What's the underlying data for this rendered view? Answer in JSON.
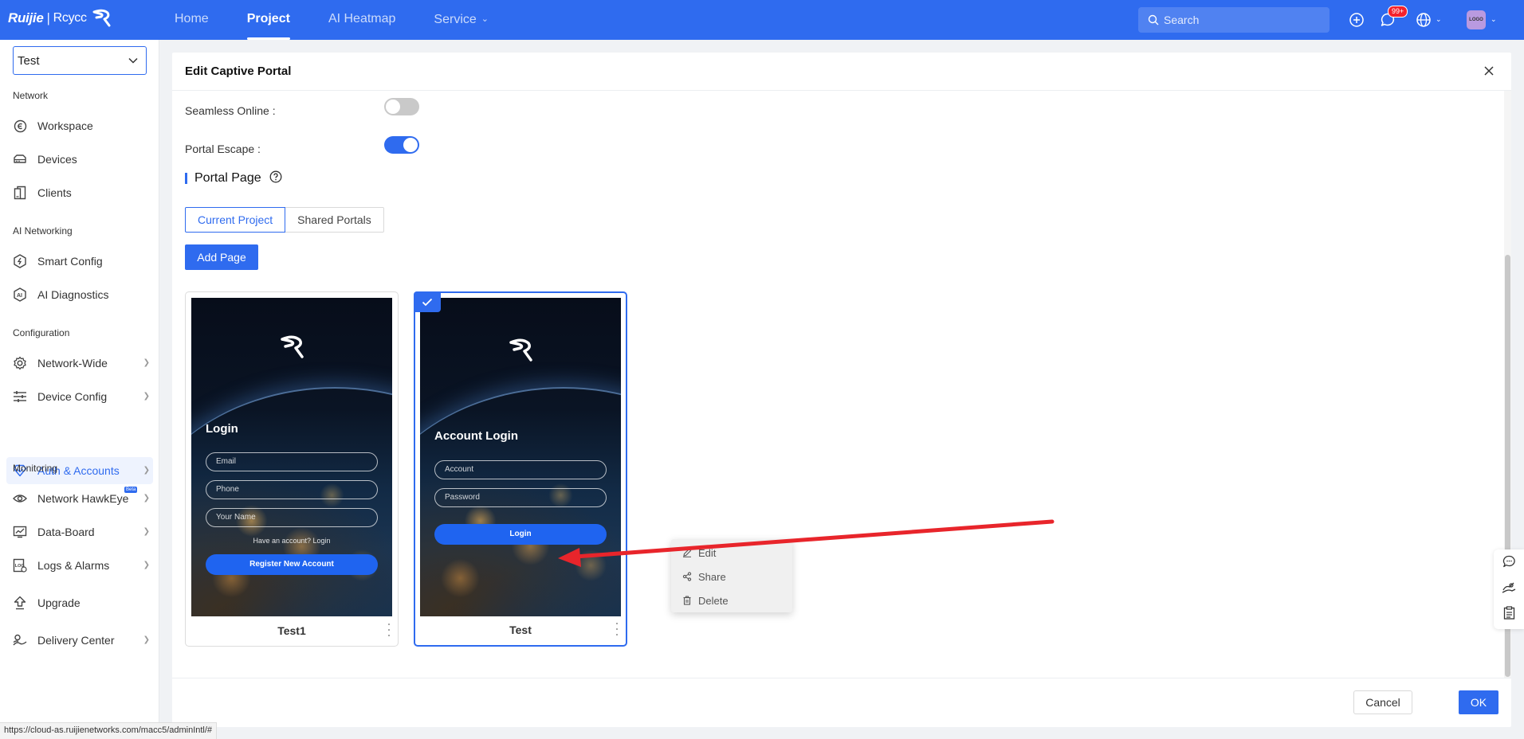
{
  "topbar": {
    "brand_primary": "Ruijie",
    "brand_separator": "|",
    "brand_secondary": "Rcycc",
    "nav": [
      {
        "label": "Home",
        "active": false
      },
      {
        "label": "Project",
        "active": true
      },
      {
        "label": "AI Heatmap",
        "active": false
      },
      {
        "label": "Service",
        "active": false
      }
    ],
    "search_placeholder": "Search",
    "notification_badge": "99+",
    "avatar_text": "LOGO"
  },
  "sidebar": {
    "project_value": "Test",
    "sections": {
      "network": "Network",
      "ai_networking": "AI Networking",
      "configuration": "Configuration",
      "monitoring": "Monitoring"
    },
    "items": {
      "workspace": "Workspace",
      "devices": "Devices",
      "clients": "Clients",
      "smart_config": "Smart Config",
      "ai_diagnostics": "AI Diagnostics",
      "network_wide": "Network-Wide",
      "device_config": "Device Config",
      "auth_accounts": "Auth & Accounts",
      "network_hawkeye": "Network HawkEye",
      "hawkeye_badge": "Beta",
      "data_board": "Data-Board",
      "logs_alarms": "Logs & Alarms",
      "upgrade": "Upgrade",
      "delivery_center": "Delivery Center"
    }
  },
  "modal": {
    "title": "Edit Captive Portal",
    "seamless_online_label": "Seamless Online :",
    "seamless_online_enabled": false,
    "portal_escape_label": "Portal Escape :",
    "portal_escape_enabled": true,
    "section_title": "Portal Page",
    "tabs": {
      "current_project": "Current Project",
      "shared_portals": "Shared Portals"
    },
    "add_page_label": "Add Page",
    "cards": [
      {
        "name": "Test1",
        "selected": false,
        "preview": {
          "title": "Login",
          "fields": [
            "Email",
            "Phone",
            "Your Name"
          ],
          "hint": "Have an account? Login",
          "button": "Register New Account"
        }
      },
      {
        "name": "Test",
        "selected": true,
        "preview": {
          "title": "Account Login",
          "fields": [
            "Account",
            "Password"
          ],
          "button": "Login"
        }
      }
    ],
    "context_menu": {
      "edit": "Edit",
      "share": "Share",
      "delete": "Delete"
    },
    "cancel_label": "Cancel",
    "ok_label": "OK"
  },
  "status_url": "https://cloud-as.ruijienetworks.com/macc5/adminIntl/#",
  "colors": {
    "primary": "#2f6bef",
    "annotation_arrow": "#e8252b"
  }
}
